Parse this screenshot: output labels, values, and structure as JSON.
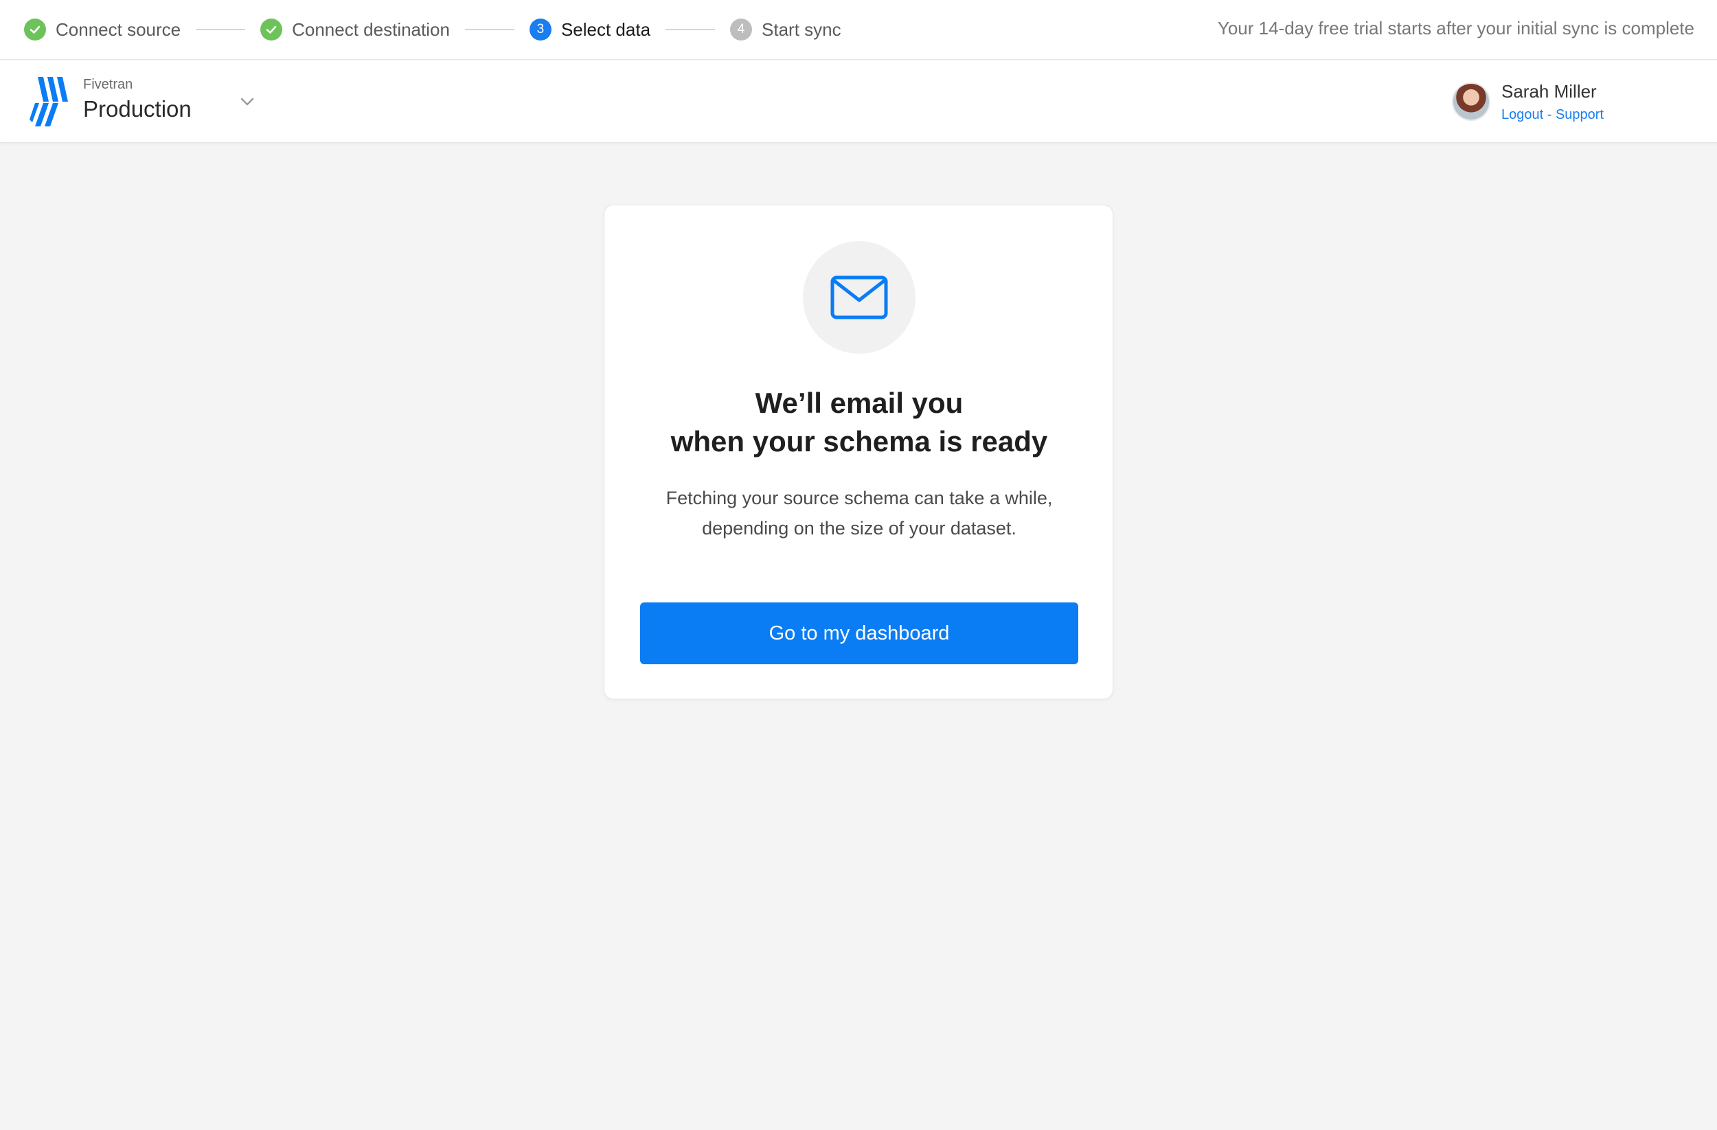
{
  "stepper": {
    "steps": [
      {
        "label": "Connect source",
        "status": "done",
        "marker": ""
      },
      {
        "label": "Connect destination",
        "status": "done",
        "marker": ""
      },
      {
        "label": "Select data",
        "status": "active",
        "marker": "3"
      },
      {
        "label": "Start sync",
        "status": "pending",
        "marker": "4"
      }
    ],
    "trial_note": "Your 14-day free trial starts after your initial sync is complete"
  },
  "header": {
    "brand_sub": "Fivetran",
    "workspace": "Production",
    "user": {
      "name": "Sarah Miller",
      "logout_label": "Logout",
      "separator": " - ",
      "support_label": "Support"
    }
  },
  "card": {
    "title_line1": "We’ll email you",
    "title_line2": "when your schema is ready",
    "desc_line1": "Fetching your source schema can take a while,",
    "desc_line2": "depending on the size of your dataset.",
    "button_label": "Go to my dashboard"
  },
  "colors": {
    "accent": "#0a7cf4",
    "step_done": "#6cc35a",
    "step_pending": "#bdbdbd",
    "background": "#f4f4f4"
  },
  "icons": {
    "step_done": "check-icon",
    "mail": "envelope-icon",
    "workspace_toggle": "chevron-down-icon",
    "logo": "fivetran-logo"
  }
}
